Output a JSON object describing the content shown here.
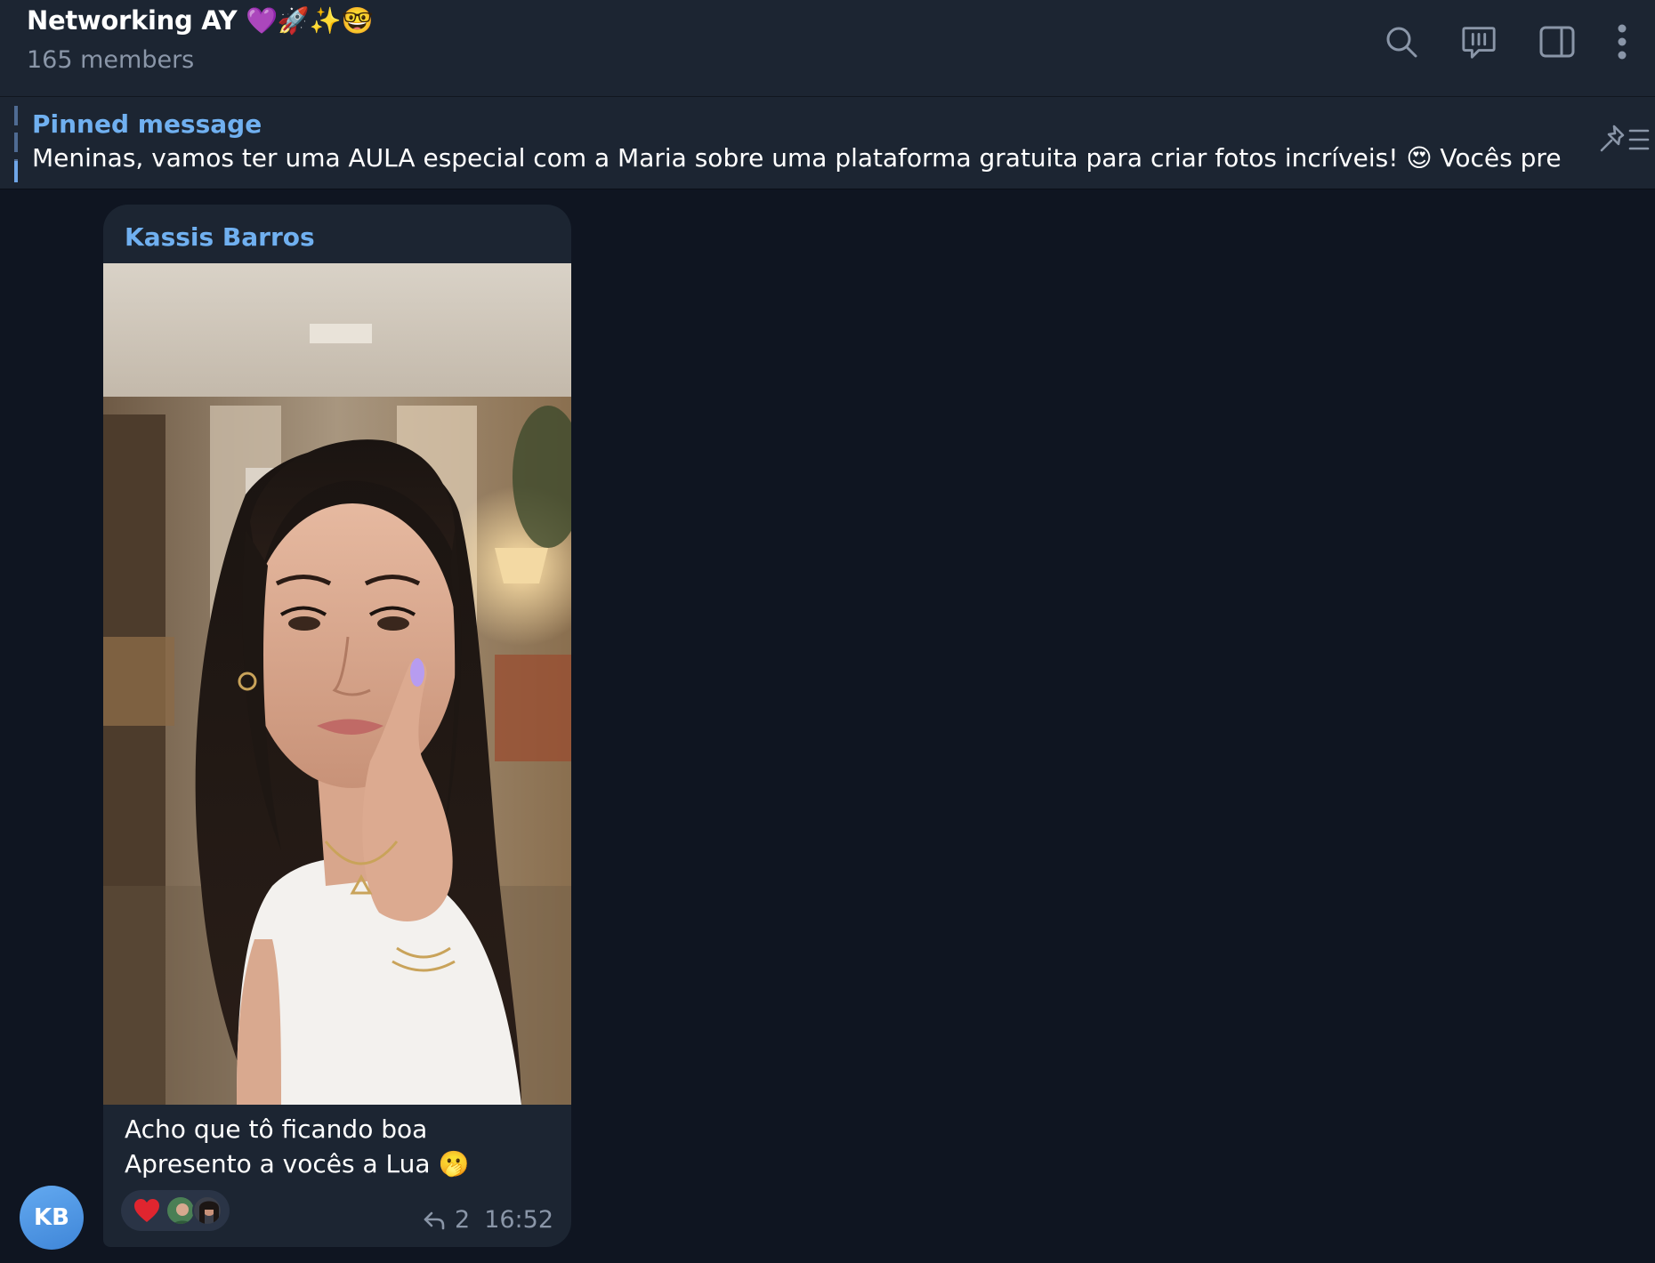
{
  "header": {
    "title": "Networking AY 💜🚀✨🤓",
    "subtitle": "165 members"
  },
  "pinned": {
    "title": "Pinned message",
    "text": "Meninas, vamos ter uma AULA especial com a Maria  sobre uma plataforma gratuita para criar fotos incríveis! 😍  Vocês precisam..."
  },
  "message": {
    "sender": "Kassis Barros",
    "caption_line1": "Acho que tô ficando boa",
    "caption_line2": "Apresento a vocês a Lua 🫢",
    "reply_count": "2",
    "time": "16:52",
    "avatar_initials": "KB"
  },
  "colors": {
    "accent": "#70b0f0",
    "header_bg": "#1c2532",
    "chat_bg": "#0f1521",
    "muted": "#8a96a8",
    "reaction_heart": "#e0252f"
  },
  "icons": [
    "search-icon",
    "discussion-icon",
    "sidebar-toggle-icon",
    "more-icon",
    "pinned-list-icon",
    "heart-icon",
    "reply-icon"
  ]
}
